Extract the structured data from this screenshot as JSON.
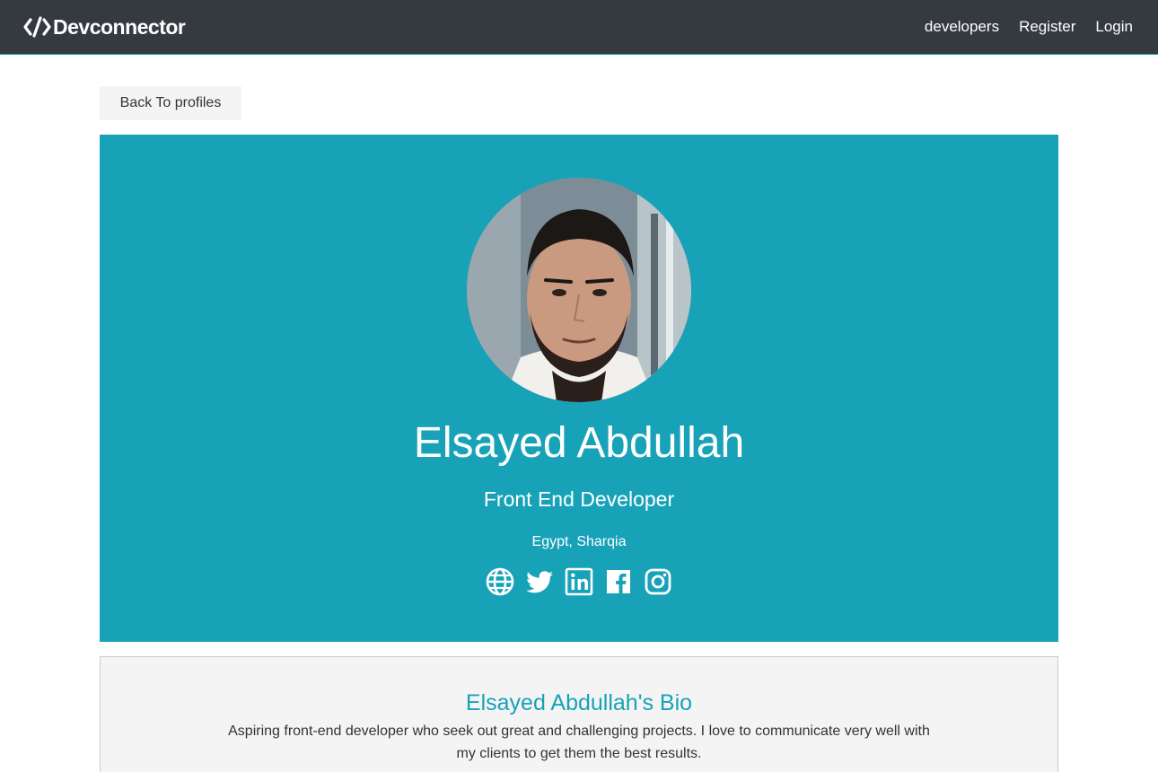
{
  "navbar": {
    "brand": "Devconnector",
    "brand_icon": "code-icon",
    "links": [
      {
        "label": "developers"
      },
      {
        "label": "Register"
      },
      {
        "label": "Login"
      }
    ]
  },
  "back_button": {
    "label": "Back To profiles"
  },
  "profile": {
    "name": "Elsayed Abdullah",
    "title": "Front End Developer",
    "location": "Egypt, Sharqia",
    "socials": [
      "globe-icon",
      "twitter-icon",
      "linkedin-icon",
      "facebook-icon",
      "instagram-icon"
    ]
  },
  "bio": {
    "heading": "Elsayed Abdullah's Bio",
    "text": "Aspiring front-end developer who seek out great and challenging projects. I love to communicate very well with my clients to get them the best results."
  },
  "colors": {
    "primary": "#17a2b8",
    "dark": "#343a40",
    "light": "#f4f4f4"
  }
}
